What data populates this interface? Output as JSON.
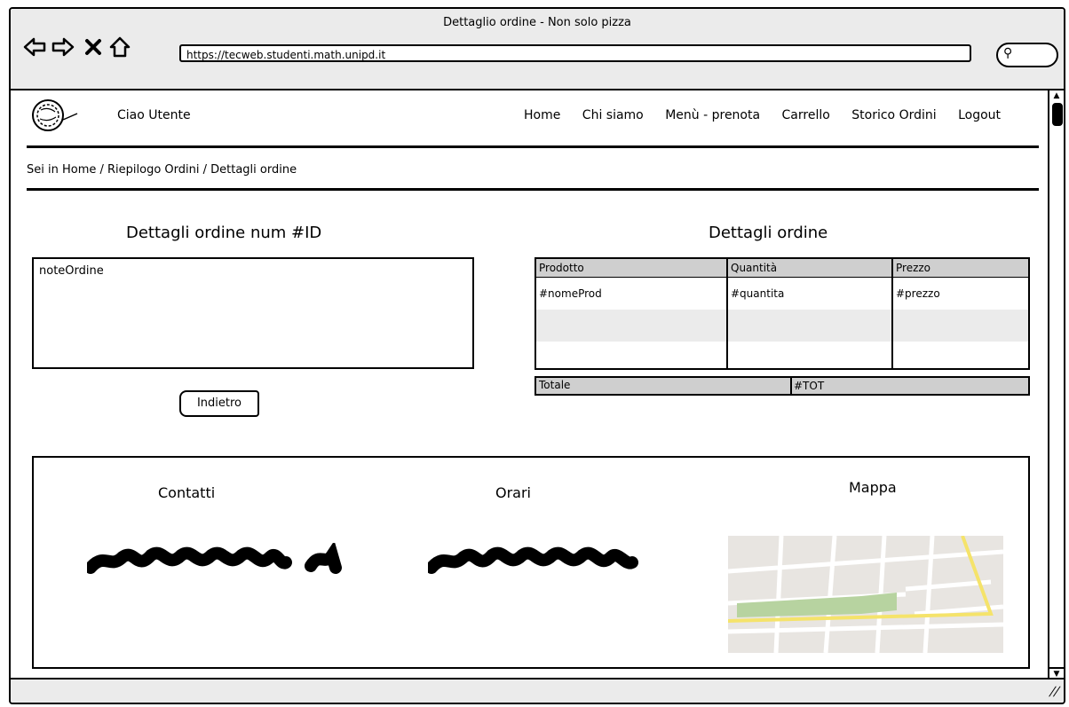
{
  "browser": {
    "window_title": "Dettaglio ordine - Non solo pizza",
    "url": "https://tecweb.studenti.math.unipd.it"
  },
  "header": {
    "greeting": "Ciao Utente",
    "nav": [
      "Home",
      "Chi siamo",
      "Menù - prenota",
      "Carrello",
      "Storico Ordini",
      "Logout"
    ]
  },
  "breadcrumb": "Sei in Home / Riepilogo Ordini / Dettagli ordine",
  "left": {
    "heading": "Dettagli ordine num #ID",
    "notes": "noteOrdine",
    "back_label": "Indietro"
  },
  "right": {
    "heading": "Dettagli ordine",
    "table": {
      "columns": [
        "Prodotto",
        "Quantità",
        "Prezzo"
      ],
      "rows": [
        [
          "#nomeProd",
          "#quantita",
          "#prezzo"
        ],
        [
          "",
          "",
          ""
        ],
        [
          "",
          "",
          ""
        ]
      ]
    },
    "total_label": "Totale",
    "total_value": "#TOT"
  },
  "footer": {
    "contacts_heading": "Contatti",
    "hours_heading": "Orari",
    "map_heading": "Mappa"
  },
  "colors": {
    "chrome": "#ebebeb",
    "table_header": "#cfcfcf",
    "map_road": "#f5e36a",
    "map_park": "#b7d3a0"
  }
}
